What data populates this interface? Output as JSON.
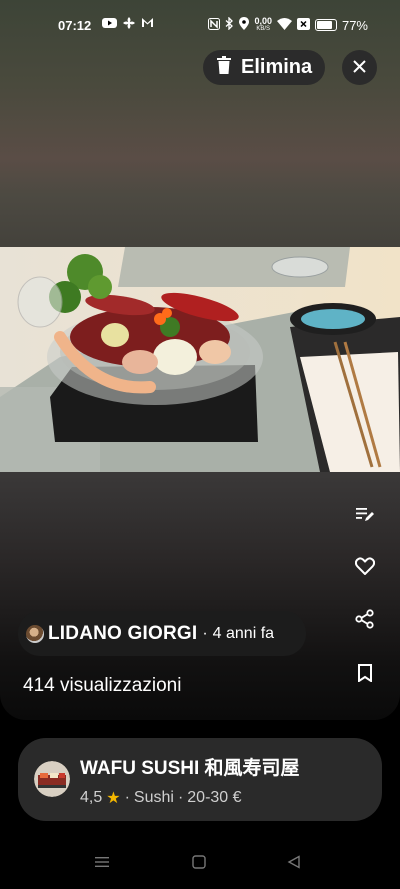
{
  "status_bar": {
    "time": "07:12",
    "network_speed": "0,00",
    "network_unit": "KB/S",
    "battery": "77%",
    "battery_level": 0.77,
    "left_icons": [
      "youtube-icon",
      "fan-icon",
      "gmail-icon"
    ],
    "right_icons": [
      "nfc-icon",
      "bluetooth-icon",
      "location-icon",
      "wifi-icon",
      "x-box-icon",
      "battery-icon"
    ]
  },
  "toolbar": {
    "delete_label": "Elimina",
    "delete_icon": "trash-icon",
    "close_icon": "close-icon"
  },
  "side_actions": [
    "edit-caption-icon",
    "heart-icon",
    "share-icon",
    "bookmark-icon"
  ],
  "author": {
    "name": "LIDANO GIORGI",
    "separator": "·",
    "time_ago": "4 anni fa"
  },
  "views": "414 visualizzazioni",
  "place": {
    "name": "WAFU SUSHI 和風寿司屋",
    "rating": "4,5",
    "rating_icon": "star-icon",
    "separator1": "·",
    "category": "Sushi",
    "separator2": "·",
    "price": "20-30 €"
  },
  "nav_bar": [
    "menu-icon",
    "home-square-icon",
    "back-triangle-icon"
  ],
  "colors": {
    "star": "#f5b800",
    "chip_bg": "#2b2b2b",
    "card_bg": "#2a2a2a"
  }
}
